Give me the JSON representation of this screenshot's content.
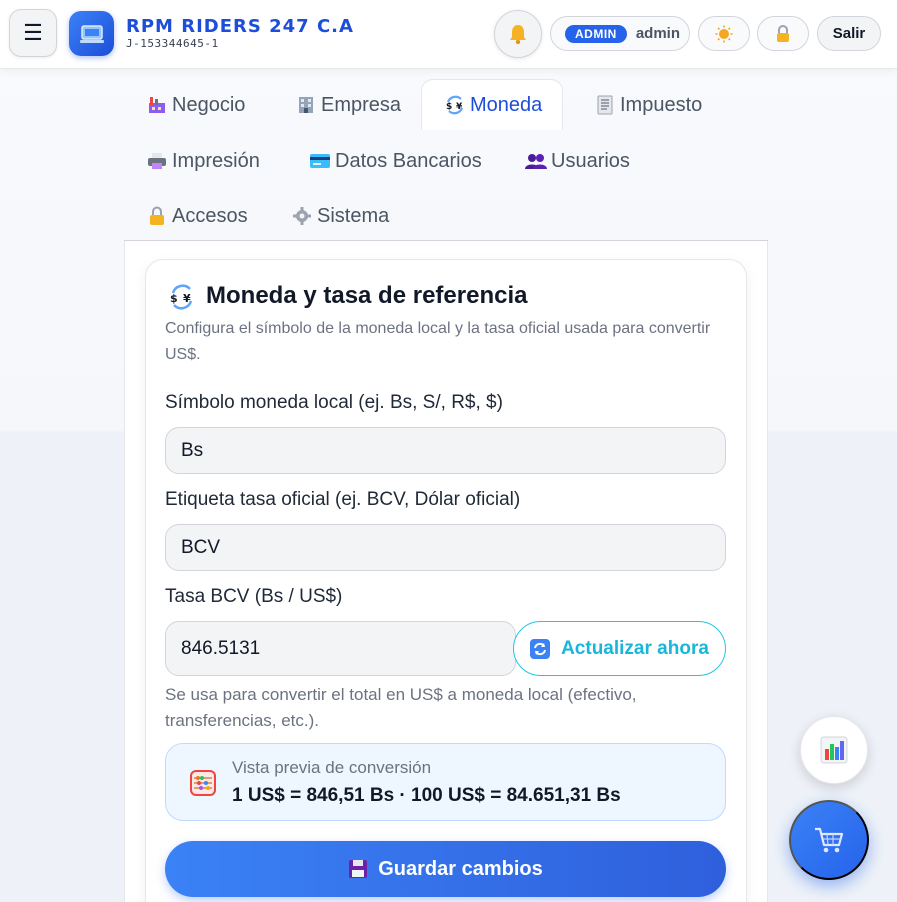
{
  "header": {
    "menu_icon": "☰",
    "brand_name": "RPM RIDERS 247 C.A",
    "brand_id": "J-153344645-1",
    "role_badge": "ADMIN",
    "username": "admin",
    "logout_label": "Salir",
    "icons": [
      "menu-icon",
      "logo-icon",
      "bell-icon",
      "sun-icon",
      "lock-icon"
    ]
  },
  "tabs": [
    {
      "label": "Negocio",
      "icon": "factory-icon"
    },
    {
      "label": "Empresa",
      "icon": "building-icon"
    },
    {
      "label": "Moneda",
      "icon": "currency-exchange-icon",
      "active": true
    },
    {
      "label": "Impuesto",
      "icon": "receipt-icon"
    },
    {
      "label": "Impresión",
      "icon": "printer-icon"
    },
    {
      "label": "Datos Bancarios",
      "icon": "credit-card-icon"
    },
    {
      "label": "Usuarios",
      "icon": "users-icon"
    },
    {
      "label": "Accesos",
      "icon": "lock-icon"
    },
    {
      "label": "Sistema",
      "icon": "gear-icon"
    }
  ],
  "card": {
    "title": "Moneda y tasa de referencia",
    "description": "Configura el símbolo de la moneda local y la tasa oficial usada para convertir US$.",
    "symbol_label": "Símbolo moneda local (ej. Bs, S/, R$, $)",
    "symbol_value": "Bs",
    "rate_label_label": "Etiqueta tasa oficial (ej. BCV, Dólar oficial)",
    "rate_label_value": "BCV",
    "rate_field_label": "Tasa BCV (Bs / US$)",
    "rate_value": "846.5131",
    "refresh_label": "Actualizar ahora",
    "hint": "Se usa para convertir el total en US$ a moneda local (efectivo, transferencias, etc.).",
    "preview_label": "Vista previa de conversión",
    "preview_value": "1 US$ = 846,51 Bs · 100 US$ = 84.651,31 Bs",
    "save_label": "Guardar cambios"
  },
  "colors": {
    "accent": "#2563eb",
    "brand": "#1d4ed8",
    "refresh": "#1ab6d9"
  }
}
